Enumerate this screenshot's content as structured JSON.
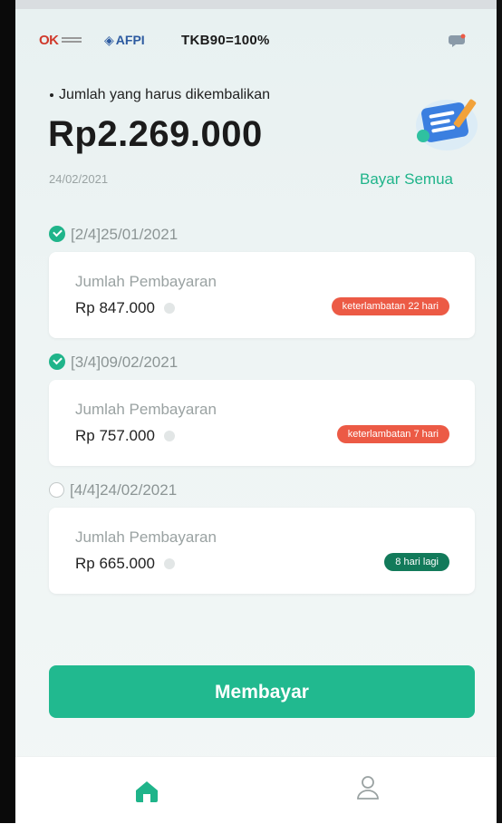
{
  "header": {
    "logo_ojk": "OK",
    "logo_afpi": "AFPI",
    "tkb": "TKB90=100%"
  },
  "summary": {
    "label": "Jumlah yang harus dikembalikan",
    "amount": "Rp2.269.000",
    "date": "24/02/2021",
    "pay_all": "Bayar Semua"
  },
  "installments": [
    {
      "status": "paid",
      "period": "[2/4]25/01/2021",
      "label": "Jumlah Pembayaran",
      "amount": "Rp 847.000",
      "badge": "keterlambatan 22 hari",
      "badge_color": "#ec5a45"
    },
    {
      "status": "paid",
      "period": "[3/4]09/02/2021",
      "label": "Jumlah Pembayaran",
      "amount": "Rp 757.000",
      "badge": "keterlambatan 7 hari",
      "badge_color": "#ec5a45"
    },
    {
      "status": "unpaid",
      "period": "[4/4]24/02/2021",
      "label": "Jumlah Pembayaran",
      "amount": "Rp 665.000",
      "badge": "8 hari lagi",
      "badge_color": "#127a5a"
    }
  ],
  "pay_button": "Membayar",
  "nav": {
    "home_icon": "home-icon",
    "profile_icon": "profile-icon"
  },
  "colors": {
    "accent": "#21b98f",
    "late": "#ec5a45",
    "due_soon": "#127a5a"
  }
}
